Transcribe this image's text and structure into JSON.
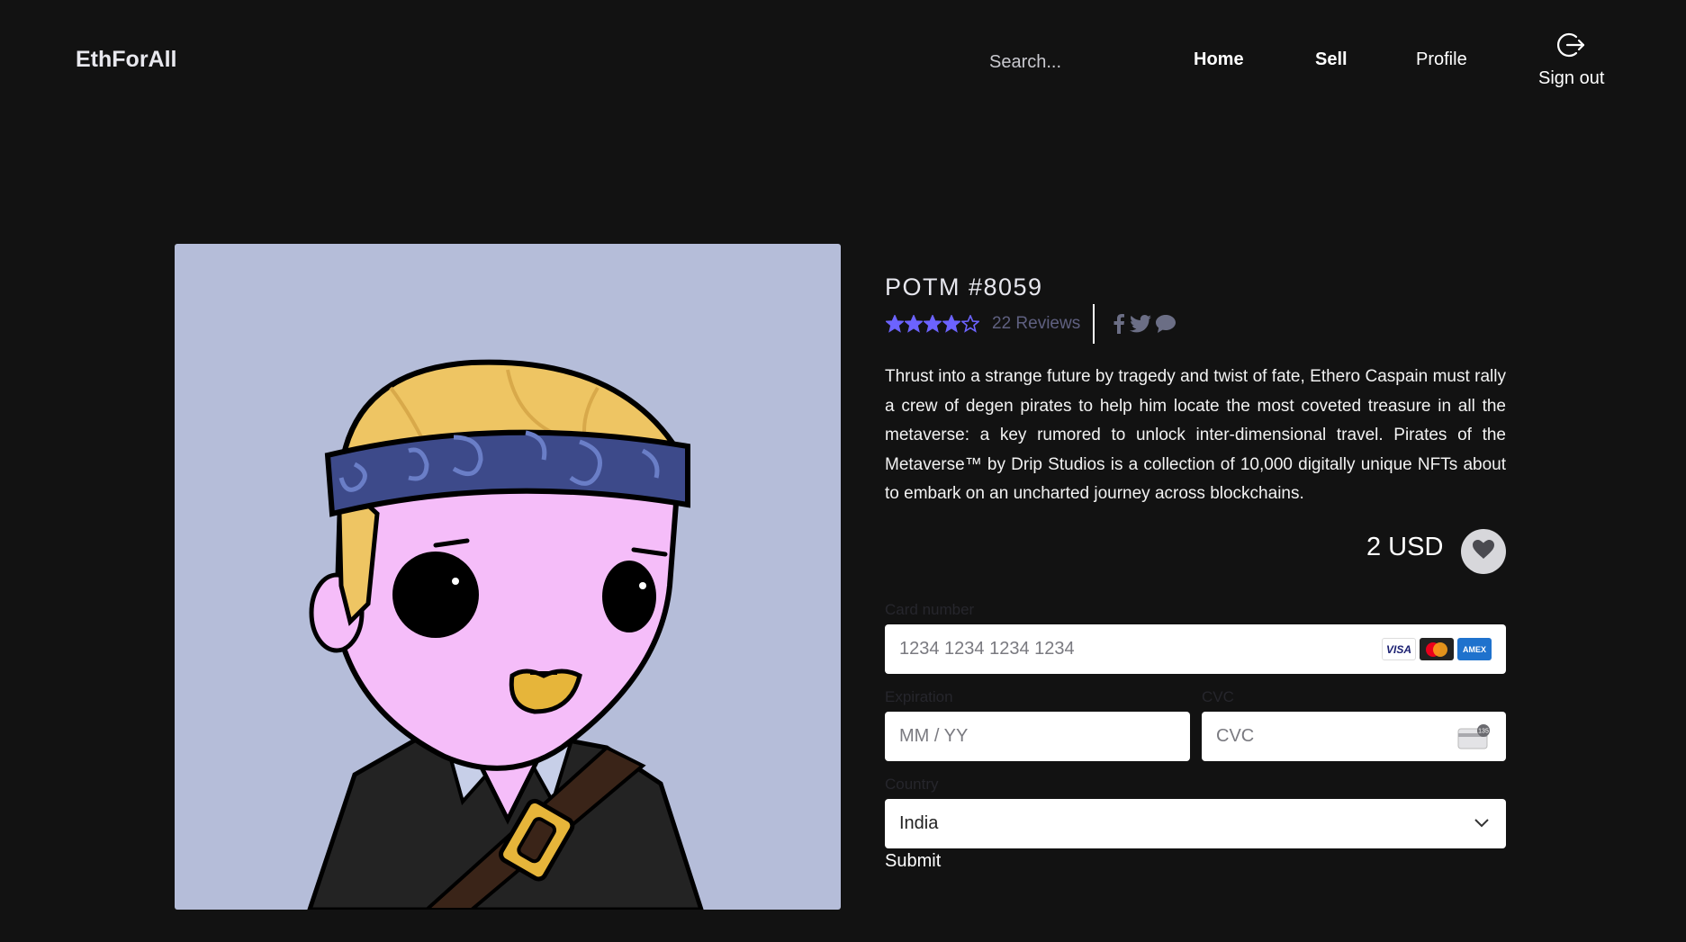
{
  "header": {
    "brand": "EthForAll",
    "search_placeholder": "Search...",
    "nav": {
      "home": "Home",
      "sell": "Sell",
      "profile": "Profile",
      "sign_out": "Sign out"
    }
  },
  "product": {
    "title": "POTM #8059",
    "rating": 4,
    "rating_max": 5,
    "reviews": "22 Reviews",
    "description": "Thrust into a strange future by tragedy and twist of fate, Ethero Caspain must rally a crew of degen pirates to help him locate the most coveted treasure in all the metaverse: a key rumored to unlock inter-dimensional travel. Pirates of the Metaverse™ by Drip Studios is a collection of 10,000 digitally unique NFTs about to embark on an uncharted journey across blockchains.",
    "price": "2 USD"
  },
  "payment": {
    "card_label": "Card number",
    "card_placeholder": "1234 1234 1234 1234",
    "card_brands": [
      "VISA",
      "Mastercard",
      "AMEX"
    ],
    "expiration_label": "Expiration",
    "expiration_placeholder": "MM / YY",
    "cvc_label": "CVC",
    "cvc_placeholder": "CVC",
    "cvc_icon_text": "135",
    "country_label": "Country",
    "country_value": "India",
    "submit": "Submit"
  },
  "colors": {
    "background": "#121212",
    "star": "#6c63ff",
    "artwork_bg": "#b5bdd9"
  }
}
